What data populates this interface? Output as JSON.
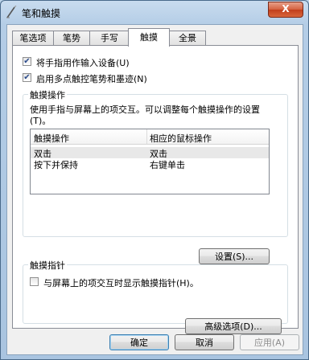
{
  "window": {
    "title": "笔和触摸",
    "close_glyph": "X"
  },
  "tabs": [
    {
      "label": "笔选项"
    },
    {
      "label": "笔势"
    },
    {
      "label": "手写"
    },
    {
      "label": "触摸"
    },
    {
      "label": "全景"
    }
  ],
  "active_tab": "触摸",
  "options": {
    "use_finger": {
      "label": "将手指用作输入设备(U)",
      "checked": true
    },
    "multitouch": {
      "label": "启用多点触控笔势和墨迹(N)",
      "checked": true
    }
  },
  "touch_actions": {
    "title": "触摸操作",
    "description": "使用手指与屏幕上的项交互。可以调整每个触摸操作的设置(T)。",
    "columns": [
      "触摸操作",
      "相应的鼠标操作"
    ],
    "rows": [
      {
        "action": "双击",
        "mouse": "双击"
      },
      {
        "action": "按下并保持",
        "mouse": "右键单击"
      }
    ],
    "settings_button": "设置(S)..."
  },
  "touch_pointer": {
    "title": "触摸指针",
    "show_pointer": {
      "label": "与屏幕上的项交互时显示触摸指针(H)。",
      "checked": false
    },
    "advanced_button": "高级选项(D)..."
  },
  "footer": {
    "ok": "确定",
    "cancel": "取消",
    "apply": "应用(A)"
  },
  "colors": {
    "titlebar": "#c9dcef",
    "close": "#c23e1c",
    "panel": "#ffffff",
    "dialog": "#f0f0f0"
  }
}
